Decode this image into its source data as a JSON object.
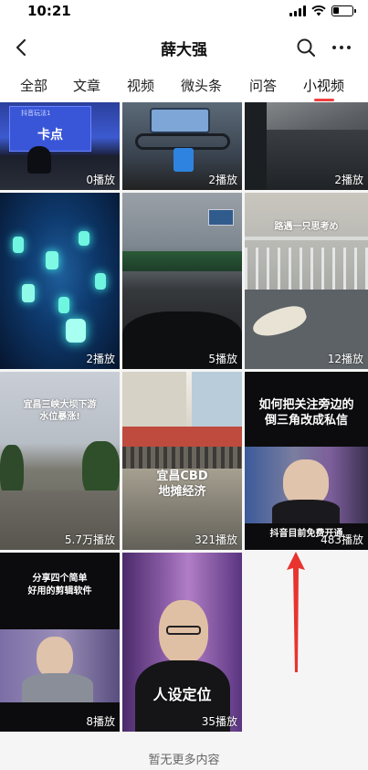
{
  "status": {
    "time": "10:21"
  },
  "header": {
    "title": "薛大强"
  },
  "tabs": [
    {
      "label": "全部"
    },
    {
      "label": "文章"
    },
    {
      "label": "视频"
    },
    {
      "label": "微头条"
    },
    {
      "label": "问答"
    },
    {
      "label": "小视频",
      "active": true
    }
  ],
  "videos": [
    {
      "plays": "0播放",
      "caption": "",
      "overlay_sign": "卡点",
      "overlay_small": "抖音玩法1"
    },
    {
      "plays": "2播放",
      "caption": ""
    },
    {
      "plays": "2播放",
      "caption": ""
    },
    {
      "plays": "2播放",
      "caption": ""
    },
    {
      "plays": "5播放",
      "caption": ""
    },
    {
      "plays": "12播放",
      "caption": "路遇一只思考め"
    },
    {
      "plays": "5.7万播放",
      "caption": "宜昌三峡大坝下游\n水位暴涨!"
    },
    {
      "plays": "321播放",
      "caption": "宜昌CBD\n地摊经济"
    },
    {
      "plays": "483播放",
      "caption": "如何把关注旁边的\n倒三角改成私信",
      "caption_bottom": "抖音目前免费开通"
    },
    {
      "plays": "8播放",
      "caption": "分享四个简单\n好用的剪辑软件"
    },
    {
      "plays": "35播放",
      "caption": "人设定位"
    }
  ],
  "footer": {
    "text": "暂无更多内容"
  },
  "colors": {
    "accent": "#f04142",
    "arrow": "#e8332f"
  }
}
